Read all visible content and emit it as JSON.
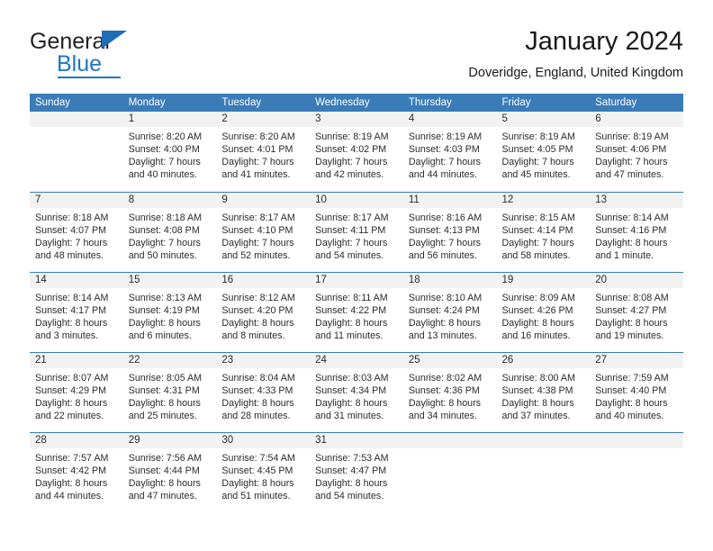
{
  "brand": {
    "name_part1": "General",
    "name_part2": "Blue",
    "accent_color": "#1f76c4",
    "triangle_color": "#1f6db5"
  },
  "header": {
    "title": "January 2024",
    "subtitle": "Doveridge, England, United Kingdom"
  },
  "calendar": {
    "header_bg": "#3a7cb8",
    "daynum_bg": "#f2f2f2",
    "weekday_headers": [
      "Sunday",
      "Monday",
      "Tuesday",
      "Wednesday",
      "Thursday",
      "Friday",
      "Saturday"
    ],
    "weeks": [
      [
        {
          "day": "",
          "lines": []
        },
        {
          "day": "1",
          "lines": [
            "Sunrise: 8:20 AM",
            "Sunset: 4:00 PM",
            "Daylight: 7 hours",
            "and 40 minutes."
          ]
        },
        {
          "day": "2",
          "lines": [
            "Sunrise: 8:20 AM",
            "Sunset: 4:01 PM",
            "Daylight: 7 hours",
            "and 41 minutes."
          ]
        },
        {
          "day": "3",
          "lines": [
            "Sunrise: 8:19 AM",
            "Sunset: 4:02 PM",
            "Daylight: 7 hours",
            "and 42 minutes."
          ]
        },
        {
          "day": "4",
          "lines": [
            "Sunrise: 8:19 AM",
            "Sunset: 4:03 PM",
            "Daylight: 7 hours",
            "and 44 minutes."
          ]
        },
        {
          "day": "5",
          "lines": [
            "Sunrise: 8:19 AM",
            "Sunset: 4:05 PM",
            "Daylight: 7 hours",
            "and 45 minutes."
          ]
        },
        {
          "day": "6",
          "lines": [
            "Sunrise: 8:19 AM",
            "Sunset: 4:06 PM",
            "Daylight: 7 hours",
            "and 47 minutes."
          ]
        }
      ],
      [
        {
          "day": "7",
          "lines": [
            "Sunrise: 8:18 AM",
            "Sunset: 4:07 PM",
            "Daylight: 7 hours",
            "and 48 minutes."
          ]
        },
        {
          "day": "8",
          "lines": [
            "Sunrise: 8:18 AM",
            "Sunset: 4:08 PM",
            "Daylight: 7 hours",
            "and 50 minutes."
          ]
        },
        {
          "day": "9",
          "lines": [
            "Sunrise: 8:17 AM",
            "Sunset: 4:10 PM",
            "Daylight: 7 hours",
            "and 52 minutes."
          ]
        },
        {
          "day": "10",
          "lines": [
            "Sunrise: 8:17 AM",
            "Sunset: 4:11 PM",
            "Daylight: 7 hours",
            "and 54 minutes."
          ]
        },
        {
          "day": "11",
          "lines": [
            "Sunrise: 8:16 AM",
            "Sunset: 4:13 PM",
            "Daylight: 7 hours",
            "and 56 minutes."
          ]
        },
        {
          "day": "12",
          "lines": [
            "Sunrise: 8:15 AM",
            "Sunset: 4:14 PM",
            "Daylight: 7 hours",
            "and 58 minutes."
          ]
        },
        {
          "day": "13",
          "lines": [
            "Sunrise: 8:14 AM",
            "Sunset: 4:16 PM",
            "Daylight: 8 hours",
            "and 1 minute."
          ]
        }
      ],
      [
        {
          "day": "14",
          "lines": [
            "Sunrise: 8:14 AM",
            "Sunset: 4:17 PM",
            "Daylight: 8 hours",
            "and 3 minutes."
          ]
        },
        {
          "day": "15",
          "lines": [
            "Sunrise: 8:13 AM",
            "Sunset: 4:19 PM",
            "Daylight: 8 hours",
            "and 6 minutes."
          ]
        },
        {
          "day": "16",
          "lines": [
            "Sunrise: 8:12 AM",
            "Sunset: 4:20 PM",
            "Daylight: 8 hours",
            "and 8 minutes."
          ]
        },
        {
          "day": "17",
          "lines": [
            "Sunrise: 8:11 AM",
            "Sunset: 4:22 PM",
            "Daylight: 8 hours",
            "and 11 minutes."
          ]
        },
        {
          "day": "18",
          "lines": [
            "Sunrise: 8:10 AM",
            "Sunset: 4:24 PM",
            "Daylight: 8 hours",
            "and 13 minutes."
          ]
        },
        {
          "day": "19",
          "lines": [
            "Sunrise: 8:09 AM",
            "Sunset: 4:26 PM",
            "Daylight: 8 hours",
            "and 16 minutes."
          ]
        },
        {
          "day": "20",
          "lines": [
            "Sunrise: 8:08 AM",
            "Sunset: 4:27 PM",
            "Daylight: 8 hours",
            "and 19 minutes."
          ]
        }
      ],
      [
        {
          "day": "21",
          "lines": [
            "Sunrise: 8:07 AM",
            "Sunset: 4:29 PM",
            "Daylight: 8 hours",
            "and 22 minutes."
          ]
        },
        {
          "day": "22",
          "lines": [
            "Sunrise: 8:05 AM",
            "Sunset: 4:31 PM",
            "Daylight: 8 hours",
            "and 25 minutes."
          ]
        },
        {
          "day": "23",
          "lines": [
            "Sunrise: 8:04 AM",
            "Sunset: 4:33 PM",
            "Daylight: 8 hours",
            "and 28 minutes."
          ]
        },
        {
          "day": "24",
          "lines": [
            "Sunrise: 8:03 AM",
            "Sunset: 4:34 PM",
            "Daylight: 8 hours",
            "and 31 minutes."
          ]
        },
        {
          "day": "25",
          "lines": [
            "Sunrise: 8:02 AM",
            "Sunset: 4:36 PM",
            "Daylight: 8 hours",
            "and 34 minutes."
          ]
        },
        {
          "day": "26",
          "lines": [
            "Sunrise: 8:00 AM",
            "Sunset: 4:38 PM",
            "Daylight: 8 hours",
            "and 37 minutes."
          ]
        },
        {
          "day": "27",
          "lines": [
            "Sunrise: 7:59 AM",
            "Sunset: 4:40 PM",
            "Daylight: 8 hours",
            "and 40 minutes."
          ]
        }
      ],
      [
        {
          "day": "28",
          "lines": [
            "Sunrise: 7:57 AM",
            "Sunset: 4:42 PM",
            "Daylight: 8 hours",
            "and 44 minutes."
          ]
        },
        {
          "day": "29",
          "lines": [
            "Sunrise: 7:56 AM",
            "Sunset: 4:44 PM",
            "Daylight: 8 hours",
            "and 47 minutes."
          ]
        },
        {
          "day": "30",
          "lines": [
            "Sunrise: 7:54 AM",
            "Sunset: 4:45 PM",
            "Daylight: 8 hours",
            "and 51 minutes."
          ]
        },
        {
          "day": "31",
          "lines": [
            "Sunrise: 7:53 AM",
            "Sunset: 4:47 PM",
            "Daylight: 8 hours",
            "and 54 minutes."
          ]
        },
        {
          "day": "",
          "lines": []
        },
        {
          "day": "",
          "lines": []
        },
        {
          "day": "",
          "lines": []
        }
      ]
    ]
  }
}
